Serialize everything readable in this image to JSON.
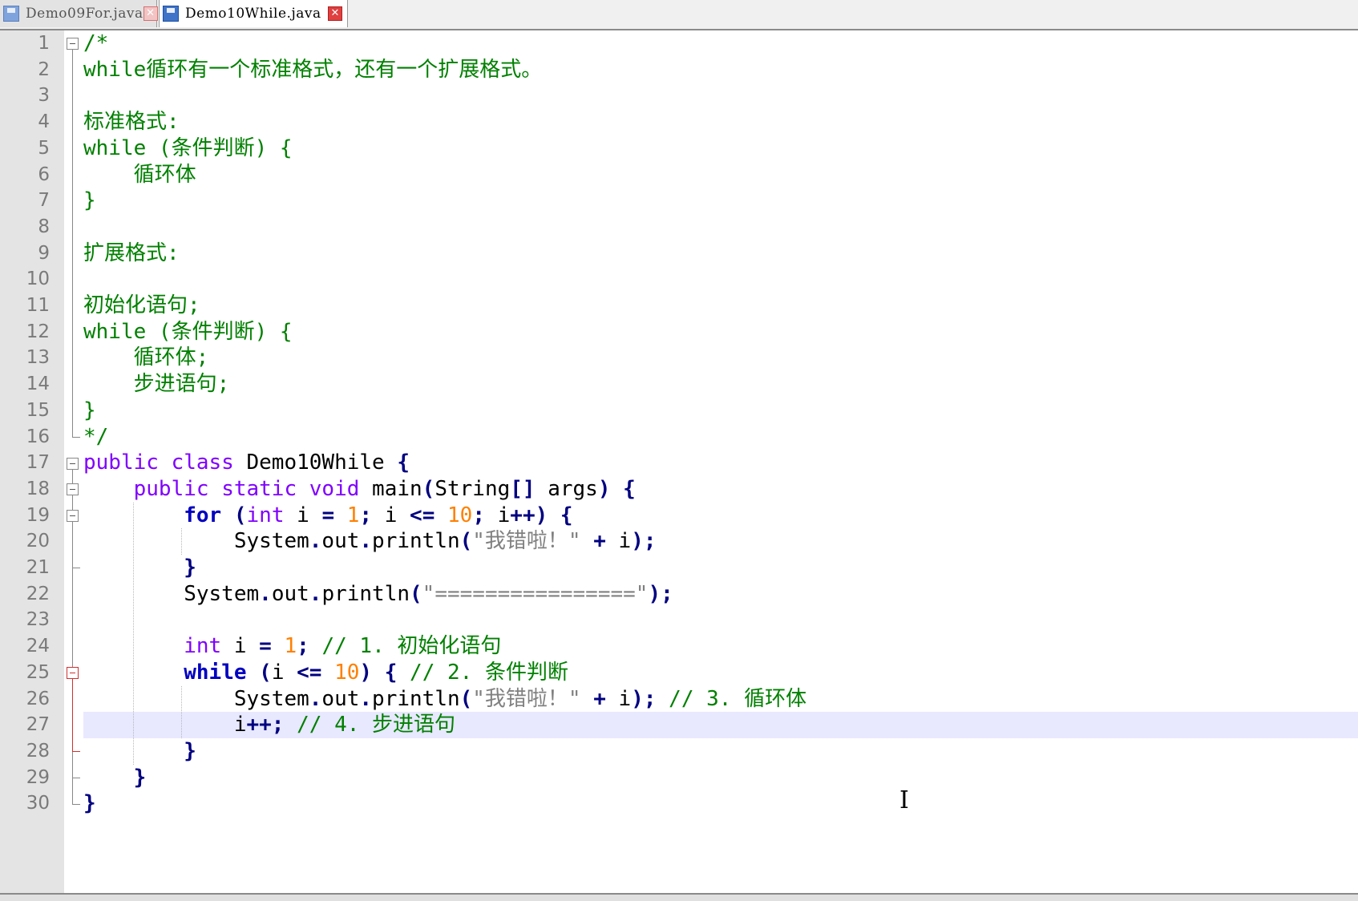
{
  "tabs": [
    {
      "label": "Demo09For.java",
      "active": false
    },
    {
      "label": "Demo10While.java",
      "active": true
    }
  ],
  "editor": {
    "current_line": 27,
    "lines": [
      {
        "n": "1",
        "tokens": [
          {
            "t": "/*",
            "c": "c"
          }
        ]
      },
      {
        "n": "2",
        "tokens": [
          {
            "t": "while循环有一个标准格式，还有一个扩展格式。",
            "c": "c"
          }
        ]
      },
      {
        "n": "3",
        "tokens": []
      },
      {
        "n": "4",
        "tokens": [
          {
            "t": "标准格式:",
            "c": "c"
          }
        ]
      },
      {
        "n": "5",
        "tokens": [
          {
            "t": "while (条件判断) {",
            "c": "c"
          }
        ]
      },
      {
        "n": "6",
        "tokens": [
          {
            "t": "    循环体",
            "c": "c"
          }
        ]
      },
      {
        "n": "7",
        "tokens": [
          {
            "t": "}",
            "c": "c"
          }
        ]
      },
      {
        "n": "8",
        "tokens": []
      },
      {
        "n": "9",
        "tokens": [
          {
            "t": "扩展格式:",
            "c": "c"
          }
        ]
      },
      {
        "n": "10",
        "tokens": []
      },
      {
        "n": "11",
        "tokens": [
          {
            "t": "初始化语句;",
            "c": "c"
          }
        ]
      },
      {
        "n": "12",
        "tokens": [
          {
            "t": "while (条件判断) {",
            "c": "c"
          }
        ]
      },
      {
        "n": "13",
        "tokens": [
          {
            "t": "    循环体;",
            "c": "c"
          }
        ]
      },
      {
        "n": "14",
        "tokens": [
          {
            "t": "    步进语句;",
            "c": "c"
          }
        ]
      },
      {
        "n": "15",
        "tokens": [
          {
            "t": "}",
            "c": "c"
          }
        ]
      },
      {
        "n": "16",
        "tokens": [
          {
            "t": "*/",
            "c": "c"
          }
        ]
      },
      {
        "n": "17",
        "tokens": [
          {
            "t": "public class",
            "c": "kw"
          },
          {
            "t": " Demo10While ",
            "c": ""
          },
          {
            "t": "{",
            "c": "o"
          }
        ]
      },
      {
        "n": "18",
        "tokens": [
          {
            "t": "    ",
            "c": ""
          },
          {
            "t": "public static void",
            "c": "kw"
          },
          {
            "t": " main",
            "c": ""
          },
          {
            "t": "(",
            "c": "o"
          },
          {
            "t": "String",
            "c": ""
          },
          {
            "t": "[]",
            "c": "o"
          },
          {
            "t": " args",
            "c": ""
          },
          {
            "t": ")",
            "c": "o"
          },
          {
            "t": " ",
            "c": ""
          },
          {
            "t": "{",
            "c": "o"
          }
        ]
      },
      {
        "n": "19",
        "tokens": [
          {
            "t": "        ",
            "c": ""
          },
          {
            "t": "for",
            "c": "kb"
          },
          {
            "t": " ",
            "c": ""
          },
          {
            "t": "(",
            "c": "o"
          },
          {
            "t": "int",
            "c": "kw"
          },
          {
            "t": " i ",
            "c": ""
          },
          {
            "t": "=",
            "c": "o"
          },
          {
            "t": " ",
            "c": ""
          },
          {
            "t": "1",
            "c": "n"
          },
          {
            "t": ";",
            "c": "o"
          },
          {
            "t": " i ",
            "c": ""
          },
          {
            "t": "<=",
            "c": "o"
          },
          {
            "t": " ",
            "c": ""
          },
          {
            "t": "10",
            "c": "n"
          },
          {
            "t": ";",
            "c": "o"
          },
          {
            "t": " i",
            "c": ""
          },
          {
            "t": "++)",
            "c": "o"
          },
          {
            "t": " ",
            "c": ""
          },
          {
            "t": "{",
            "c": "o"
          }
        ]
      },
      {
        "n": "20",
        "tokens": [
          {
            "t": "            System",
            "c": ""
          },
          {
            "t": ".",
            "c": "o"
          },
          {
            "t": "out",
            "c": ""
          },
          {
            "t": ".",
            "c": "o"
          },
          {
            "t": "println",
            "c": ""
          },
          {
            "t": "(",
            "c": "o"
          },
          {
            "t": "\"我错啦！\"",
            "c": "s"
          },
          {
            "t": " ",
            "c": ""
          },
          {
            "t": "+",
            "c": "o"
          },
          {
            "t": " i",
            "c": ""
          },
          {
            "t": ");",
            "c": "o"
          }
        ]
      },
      {
        "n": "21",
        "tokens": [
          {
            "t": "        ",
            "c": ""
          },
          {
            "t": "}",
            "c": "o"
          }
        ]
      },
      {
        "n": "22",
        "tokens": [
          {
            "t": "        System",
            "c": ""
          },
          {
            "t": ".",
            "c": "o"
          },
          {
            "t": "out",
            "c": ""
          },
          {
            "t": ".",
            "c": "o"
          },
          {
            "t": "println",
            "c": ""
          },
          {
            "t": "(",
            "c": "o"
          },
          {
            "t": "\"================\"",
            "c": "s"
          },
          {
            "t": ");",
            "c": "o"
          }
        ]
      },
      {
        "n": "23",
        "tokens": []
      },
      {
        "n": "24",
        "tokens": [
          {
            "t": "        ",
            "c": ""
          },
          {
            "t": "int",
            "c": "kw"
          },
          {
            "t": " i ",
            "c": ""
          },
          {
            "t": "=",
            "c": "o"
          },
          {
            "t": " ",
            "c": ""
          },
          {
            "t": "1",
            "c": "n"
          },
          {
            "t": ";",
            "c": "o"
          },
          {
            "t": " // 1. 初始化语句",
            "c": "c"
          }
        ]
      },
      {
        "n": "25",
        "tokens": [
          {
            "t": "        ",
            "c": ""
          },
          {
            "t": "while",
            "c": "kb"
          },
          {
            "t": " ",
            "c": ""
          },
          {
            "t": "(",
            "c": "o"
          },
          {
            "t": "i ",
            "c": ""
          },
          {
            "t": "<=",
            "c": "o"
          },
          {
            "t": " ",
            "c": ""
          },
          {
            "t": "10",
            "c": "n"
          },
          {
            "t": ")",
            "c": "o"
          },
          {
            "t": " ",
            "c": ""
          },
          {
            "t": "{",
            "c": "o"
          },
          {
            "t": " // 2. 条件判断",
            "c": "c"
          }
        ]
      },
      {
        "n": "26",
        "tokens": [
          {
            "t": "            System",
            "c": ""
          },
          {
            "t": ".",
            "c": "o"
          },
          {
            "t": "out",
            "c": ""
          },
          {
            "t": ".",
            "c": "o"
          },
          {
            "t": "println",
            "c": ""
          },
          {
            "t": "(",
            "c": "o"
          },
          {
            "t": "\"我错啦！\"",
            "c": "s"
          },
          {
            "t": " ",
            "c": ""
          },
          {
            "t": "+",
            "c": "o"
          },
          {
            "t": " i",
            "c": ""
          },
          {
            "t": ");",
            "c": "o"
          },
          {
            "t": " // 3. 循环体",
            "c": "c"
          }
        ]
      },
      {
        "n": "27",
        "tokens": [
          {
            "t": "            i",
            "c": ""
          },
          {
            "t": "++;",
            "c": "o"
          },
          {
            "t": " // 4. 步进语句",
            "c": "c"
          }
        ]
      },
      {
        "n": "28",
        "tokens": [
          {
            "t": "        ",
            "c": ""
          },
          {
            "t": "}",
            "c": "o"
          }
        ]
      },
      {
        "n": "29",
        "tokens": [
          {
            "t": "    ",
            "c": ""
          },
          {
            "t": "}",
            "c": "o"
          }
        ]
      },
      {
        "n": "30",
        "tokens": [
          {
            "t": "}",
            "c": "o"
          }
        ]
      }
    ]
  }
}
